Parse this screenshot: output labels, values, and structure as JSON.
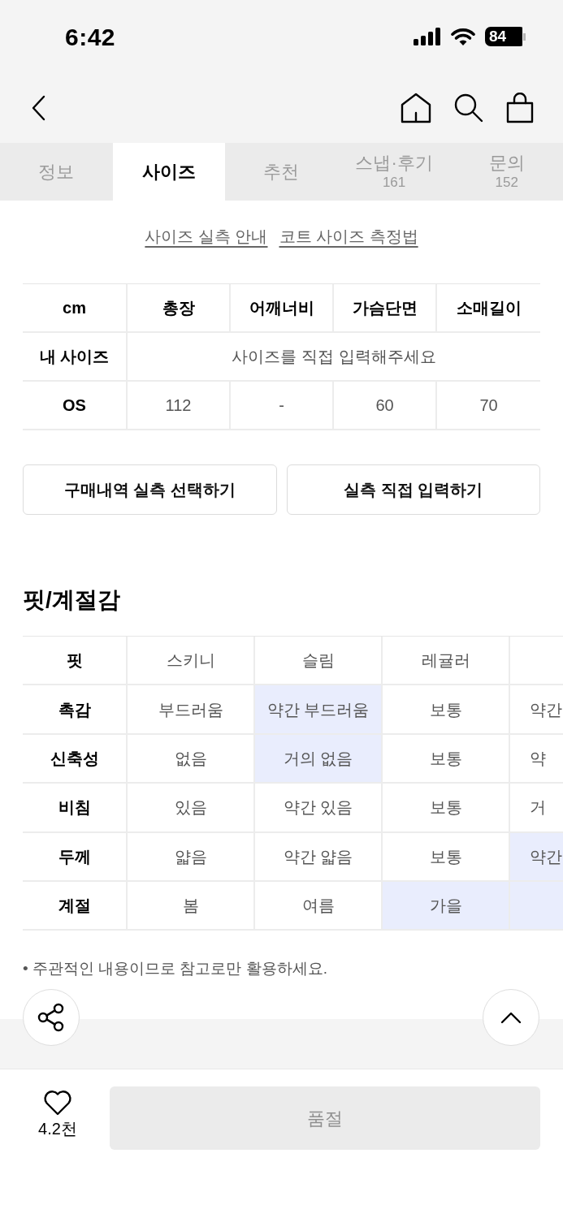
{
  "status_bar": {
    "time": "6:42",
    "battery": "84"
  },
  "tabs": [
    {
      "label": "정보",
      "selected": false
    },
    {
      "label": "사이즈",
      "selected": true
    },
    {
      "label": "추천",
      "selected": false
    },
    {
      "label": "스냅·후기",
      "count": "161",
      "selected": false
    },
    {
      "label": "문의",
      "count": "152",
      "selected": false
    }
  ],
  "guide_links": [
    "사이즈 실측 안내",
    "코트 사이즈 측정법"
  ],
  "size_table": {
    "corner": "cm",
    "columns": [
      "총장",
      "어깨너비",
      "가슴단면",
      "소매길이"
    ],
    "rows": [
      {
        "label": "내 사이즈",
        "cells": [
          {
            "text": "사이즈를 직접 입력해주세요",
            "colspan": 4
          }
        ]
      },
      {
        "label": "OS",
        "cells": [
          {
            "text": "112"
          },
          {
            "text": "-"
          },
          {
            "text": "60"
          },
          {
            "text": "70"
          }
        ]
      }
    ]
  },
  "size_buttons": [
    "구매내역 실측 선택하기",
    "실측 직접 입력하기"
  ],
  "fit_section": {
    "title": "핏/계절감",
    "rows": [
      {
        "label": "핏",
        "cells": [
          {
            "text": "스키니",
            "selected": false
          },
          {
            "text": "슬림",
            "selected": false
          },
          {
            "text": "레귤러",
            "selected": false
          },
          {
            "selected": false
          }
        ]
      },
      {
        "label": "촉감",
        "cells": [
          {
            "text": "부드러움",
            "selected": false
          },
          {
            "text": "약간 부드러움",
            "selected": true
          },
          {
            "text": "보통",
            "selected": false
          },
          {
            "text": "약간",
            "selected": false
          }
        ]
      },
      {
        "label": "신축성",
        "cells": [
          {
            "text": "없음",
            "selected": false
          },
          {
            "text": "거의 없음",
            "selected": true
          },
          {
            "text": "보통",
            "selected": false
          },
          {
            "text": "약",
            "selected": false
          }
        ]
      },
      {
        "label": "비침",
        "cells": [
          {
            "text": "있음",
            "selected": false
          },
          {
            "text": "약간 있음",
            "selected": false
          },
          {
            "text": "보통",
            "selected": false
          },
          {
            "text": "거",
            "selected": false
          }
        ]
      },
      {
        "label": "두께",
        "cells": [
          {
            "text": "얇음",
            "selected": false
          },
          {
            "text": "약간 얇음",
            "selected": false
          },
          {
            "text": "보통",
            "selected": false
          },
          {
            "text": "약간",
            "selected": true
          }
        ]
      },
      {
        "label": "계절",
        "cells": [
          {
            "text": "봄",
            "selected": false
          },
          {
            "text": "여름",
            "selected": false
          },
          {
            "text": "가을",
            "selected": true
          },
          {
            "selected": true
          }
        ]
      }
    ],
    "note": "• 주관적인 내용이므로 참고로만 활용하세요."
  },
  "bottom_bar": {
    "likes": "4.2천",
    "buy_button": {
      "label": "품절",
      "disabled": true
    }
  }
}
